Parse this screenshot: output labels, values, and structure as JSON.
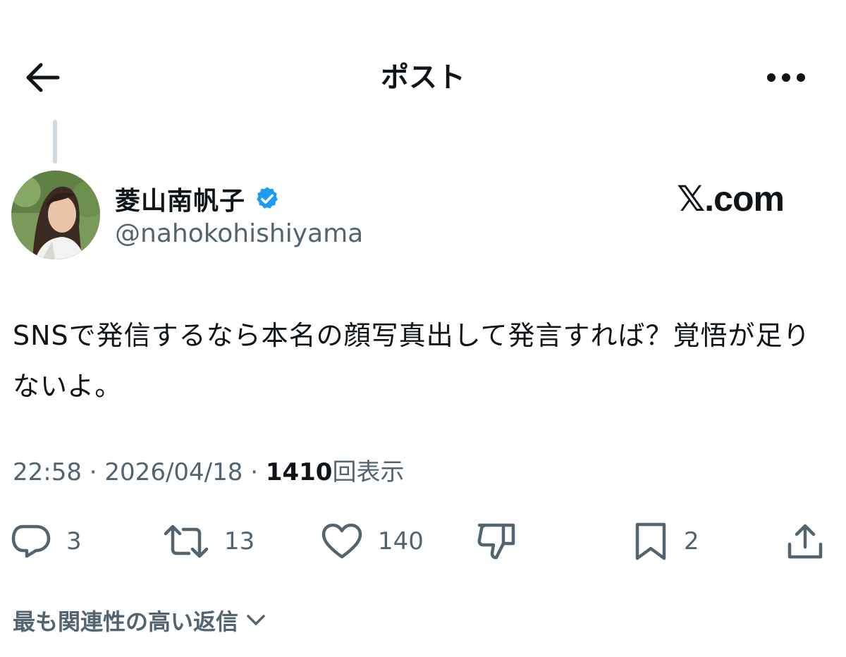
{
  "header": {
    "title": "ポスト",
    "back_icon": "arrow-left-icon",
    "more_icon": "more-horizontal-icon"
  },
  "author": {
    "display_name": "菱山南帆子",
    "verified_icon": "verified-badge-icon",
    "verified_color": "#1d9bf0",
    "handle": "@nahokohishiyama"
  },
  "watermark": {
    "text": "𝕏.com"
  },
  "post": {
    "text": "SNSで発信するなら本名の顔写真出して発言すれば？覚悟が足りないよ。"
  },
  "meta": {
    "time": "22:58",
    "sep1": " · ",
    "date": "2026/04/18",
    "sep2": " · ",
    "views_count": "1410",
    "views_label": "回表示"
  },
  "actions": {
    "reply_count": "3",
    "repost_count": "13",
    "like_count": "140",
    "bookmark_count": "2"
  },
  "replies": {
    "sort_label": "最も関連性の高い返信"
  },
  "colors": {
    "text_primary": "#0f1419",
    "text_secondary": "#536471",
    "thread_line": "#cfd9de"
  }
}
